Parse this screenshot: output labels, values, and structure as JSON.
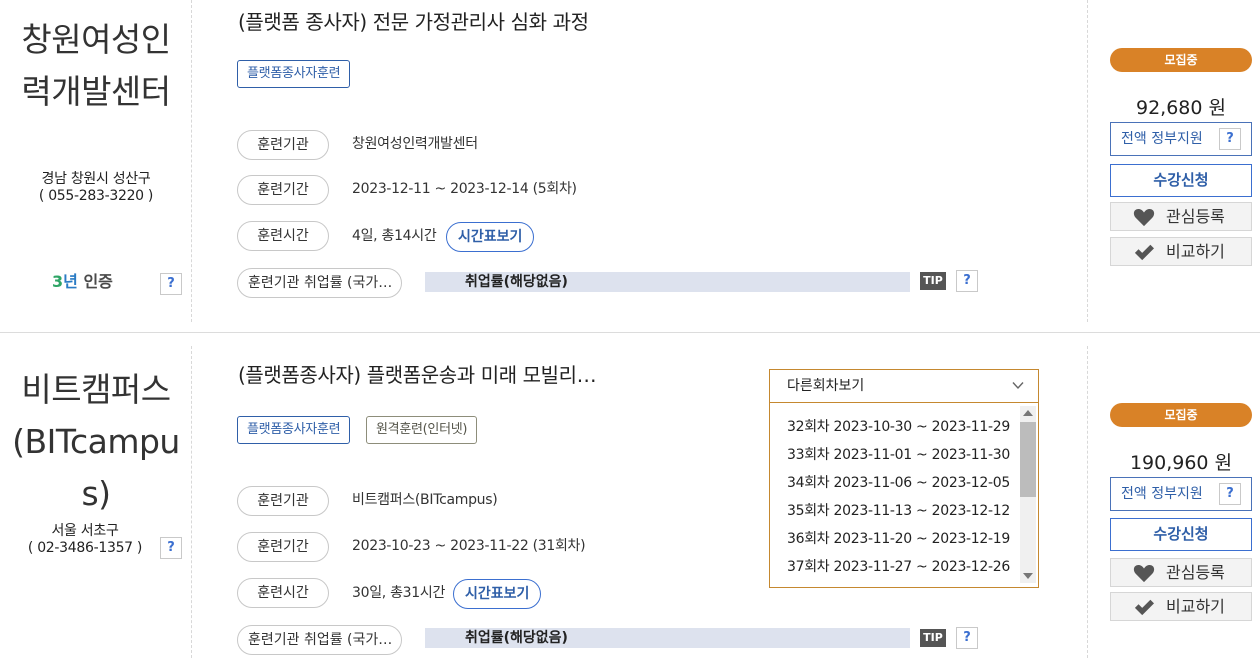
{
  "common": {
    "help_glyph": "?",
    "tip_label": "TIP",
    "status_badge": "모집중",
    "gov_support_label": "전액 정부지원",
    "apply_label": "수강신청",
    "wishlist_label": "관심등록",
    "compare_label": "비교하기",
    "schedule_button_label": "시간표보기",
    "field_labels": {
      "institution": "훈련기관",
      "period": "훈련기간",
      "hours": "훈련시간",
      "employment": "훈련기관 취업률 (국가…"
    },
    "employment_value": "취업률(해당없음)"
  },
  "courses": [
    {
      "org_name_line1": "창원여성인",
      "org_name_line2": "력개발센터",
      "org_location": "경남 창원시 성산구",
      "org_phone": "( 055-283-3220 )",
      "certification": {
        "num": "3",
        "unit": "년",
        "label": "인증"
      },
      "title": "(플랫폼 종사자) 전문 가정관리사 심화 과정",
      "tags": [
        "플랫폼종사자훈련"
      ],
      "institution": "창원여성인력개발센터",
      "period": "2023-12-11 ~ 2023-12-14 (5회차)",
      "hours": "4일, 총14시간",
      "price": "92,680 원"
    },
    {
      "org_name_line1": "비트캠퍼스",
      "org_name_line2": "(BITcampu",
      "org_name_line3": "s)",
      "org_location": "서울 서초구",
      "org_phone": "( 02-3486-1357 )",
      "title": "(플랫폼종사자) 플랫폼운송과 미래 모빌리…",
      "tags": [
        "플랫폼종사자훈련",
        "원격훈련(인터넷)"
      ],
      "institution": "비트캠퍼스(BITcampus)",
      "period": "2023-10-23 ~ 2023-11-22 (31회차)",
      "hours": "30일, 총31시간",
      "price": "190,960 원",
      "session_dropdown": {
        "label": "다른회차보기",
        "options": [
          "32회차 2023-10-30 ~ 2023-11-29",
          "33회차 2023-11-01 ~ 2023-11-30",
          "34회차 2023-11-06 ~ 2023-12-05",
          "35회차 2023-11-13 ~ 2023-12-12",
          "36회차 2023-11-20 ~ 2023-12-19",
          "37회차 2023-11-27 ~ 2023-12-26"
        ]
      }
    }
  ],
  "colors": {
    "badge_orange": "#d98227",
    "accent_blue": "#2f5fa8",
    "employment_bar": "#dde2ee",
    "dropdown_border": "#c5882f"
  }
}
